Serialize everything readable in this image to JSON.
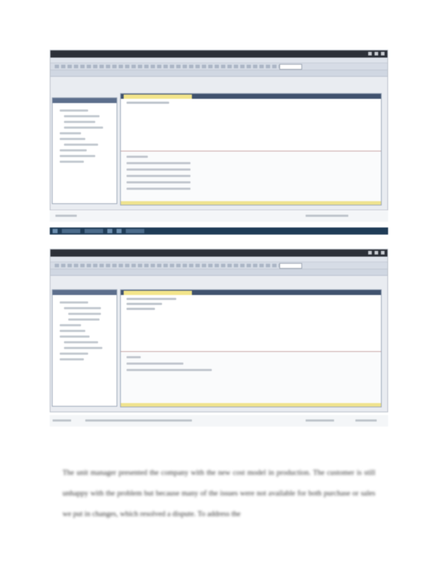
{
  "screenshots": [
    {
      "title": "",
      "active_tab": "",
      "status_text": ""
    },
    {
      "title": "",
      "active_tab": "",
      "status_text": ""
    }
  ],
  "paragraph": {
    "text": "The unit manager presented the company with the new cost model in production. The customer is still unhappy with the problem but because many of the issues were not available for both purchase or sales we put in changes, which resolved a dispute. To address the"
  },
  "colors": {
    "titlebar": "#2c3038",
    "tab_highlight": "#f3e58a",
    "taskbar": "#1f3c57",
    "explorer_header": "#5c6e8c"
  }
}
